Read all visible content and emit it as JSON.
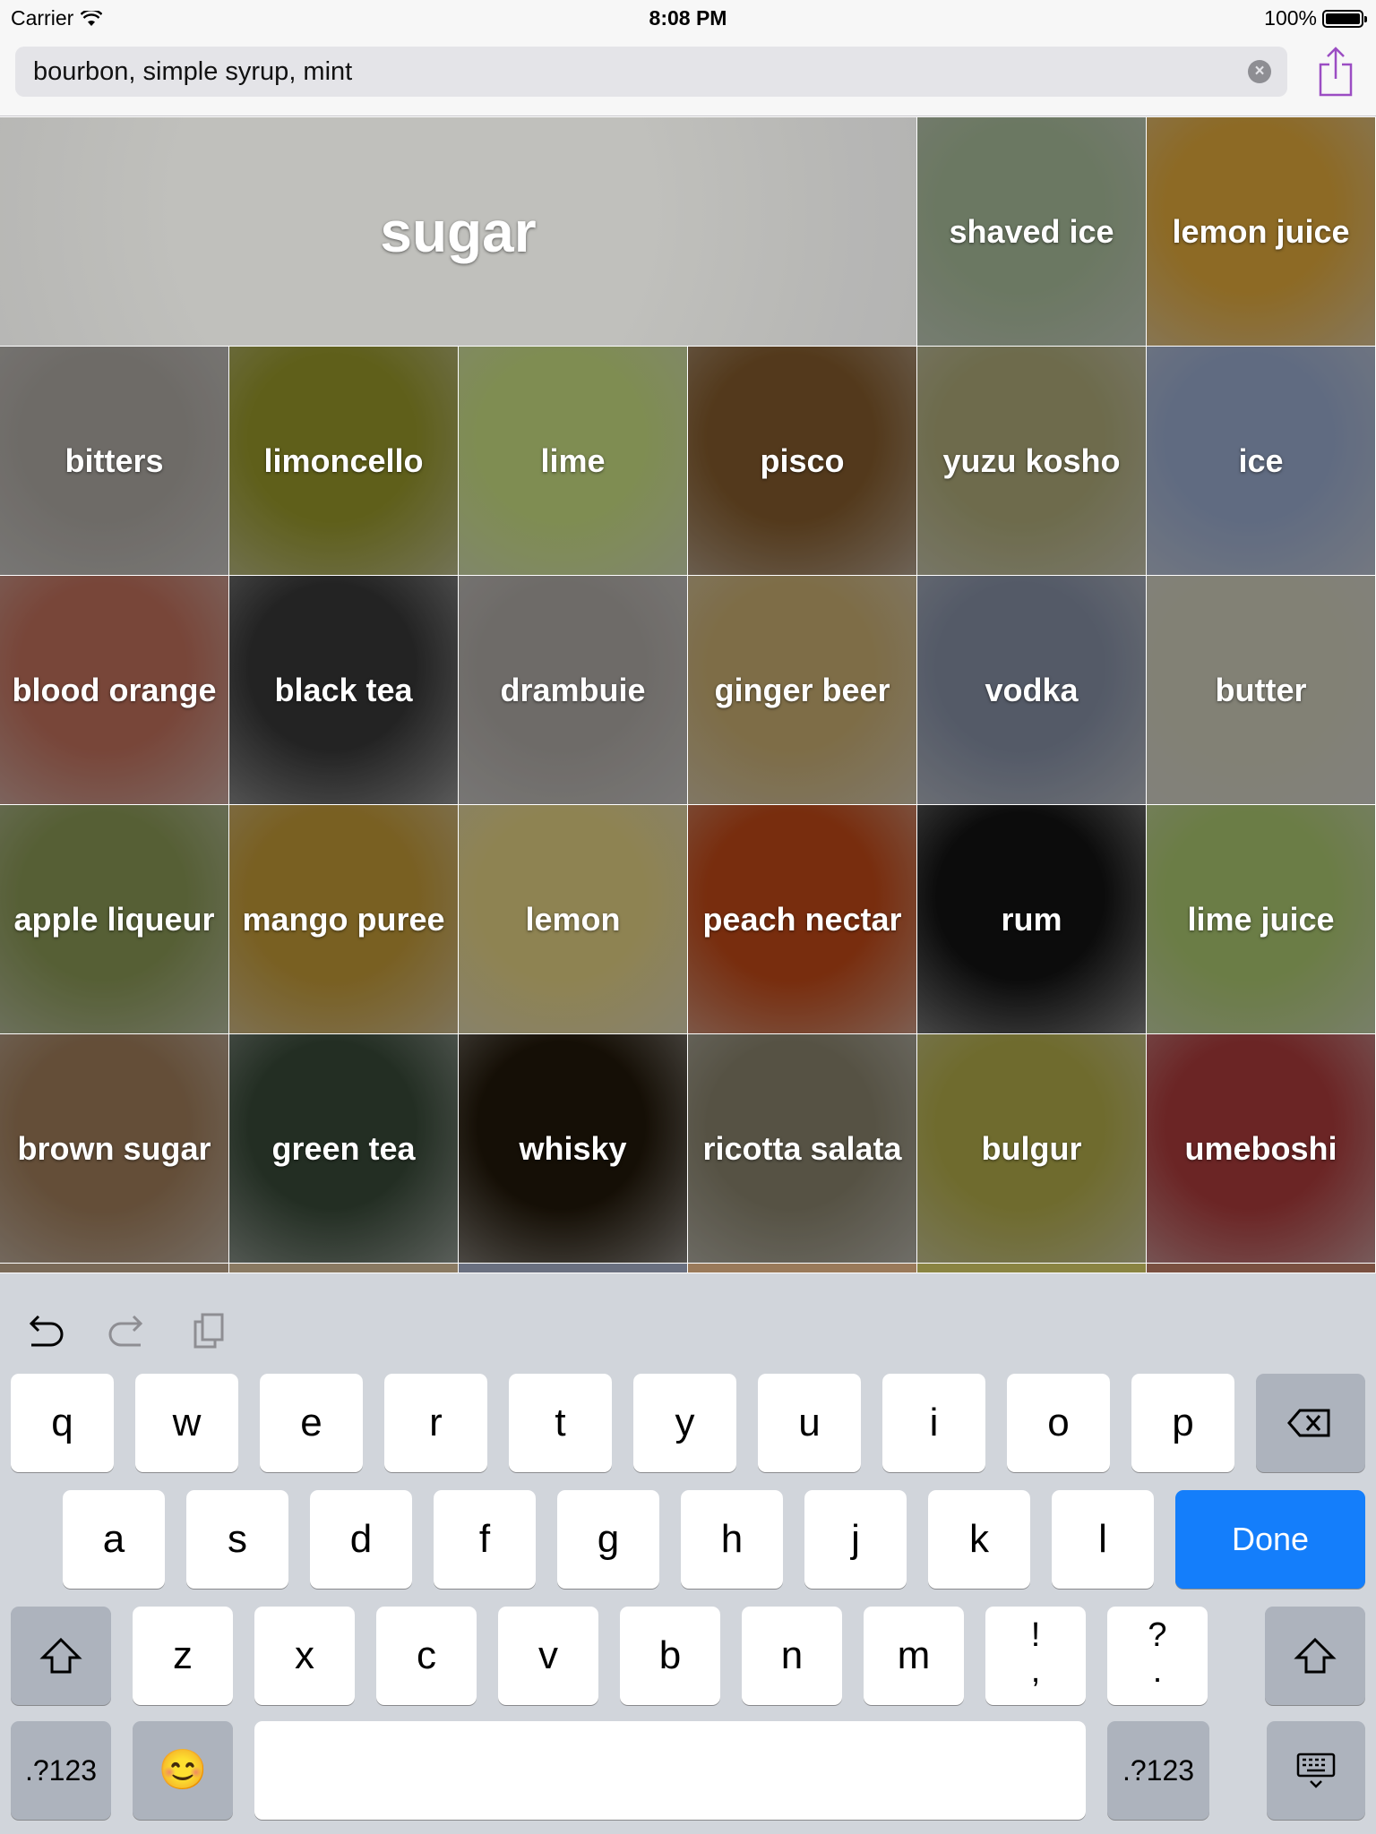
{
  "status_bar": {
    "carrier": "Carrier",
    "time": "8:08 PM",
    "battery": "100%"
  },
  "search": {
    "value": "bourbon, simple syrup, mint",
    "clear_icon": "clear-icon",
    "share_icon": "share-icon"
  },
  "tiles": [
    {
      "label": "sugar",
      "bg": "#bdbdb9"
    },
    {
      "label": "shaved ice",
      "bg": "#8a9a7e"
    },
    {
      "label": "lemon juice",
      "bg": "#b58830"
    },
    {
      "label": "bitters",
      "bg": "#8e8a85"
    },
    {
      "label": "limoncello",
      "bg": "#7a7a22"
    },
    {
      "label": "lime",
      "bg": "#a3b56a"
    },
    {
      "label": "pisco",
      "bg": "#6b4a24"
    },
    {
      "label": "yuzu kosho",
      "bg": "#8d8a62"
    },
    {
      "label": "ice",
      "bg": "#7c8aa6"
    },
    {
      "label": "blood orange",
      "bg": "#9a5a4a"
    },
    {
      "label": "black tea",
      "bg": "#2e2e2e"
    },
    {
      "label": "drambuie",
      "bg": "#8e8a86"
    },
    {
      "label": "ginger beer",
      "bg": "#a28c5c"
    },
    {
      "label": "vodka",
      "bg": "#6c7485"
    },
    {
      "label": "butter",
      "bg": "#a7a696"
    },
    {
      "label": "apple liqueur",
      "bg": "#6f7a45"
    },
    {
      "label": "mango puree",
      "bg": "#9c7b2c"
    },
    {
      "label": "lemon",
      "bg": "#b7a86a"
    },
    {
      "label": "peach nectar",
      "bg": "#9a3a12"
    },
    {
      "label": "rum",
      "bg": "#101010"
    },
    {
      "label": "lime juice",
      "bg": "#8aa05a"
    },
    {
      "label": "brown sugar",
      "bg": "#806448"
    },
    {
      "label": "green tea",
      "bg": "#2e3c2e"
    },
    {
      "label": "whisky",
      "bg": "#1c1408"
    },
    {
      "label": "ricotta salata",
      "bg": "#6f6a58"
    },
    {
      "label": "bulgur",
      "bg": "#8f8a3c"
    },
    {
      "label": "umeboshi",
      "bg": "#8a3030"
    }
  ],
  "partial_tile_colors": [
    "#7a6a58",
    "#8a7a62",
    "#6a7080",
    "#9a7a5a",
    "#8a8442",
    "#7a5040"
  ],
  "toolbar": {
    "undo_icon": "undo-icon",
    "redo_icon": "redo-icon",
    "paste_icon": "paste-icon"
  },
  "keyboard": {
    "row1": [
      "q",
      "w",
      "e",
      "r",
      "t",
      "y",
      "u",
      "i",
      "o",
      "p"
    ],
    "row2": [
      "a",
      "s",
      "d",
      "f",
      "g",
      "h",
      "j",
      "k",
      "l"
    ],
    "row3": [
      "z",
      "x",
      "c",
      "v",
      "b",
      "n",
      "m"
    ],
    "row3_punct": [
      {
        "top": "!",
        "bottom": ","
      },
      {
        "top": "?",
        "bottom": "."
      }
    ],
    "done_label": "Done",
    "numbers_label": ".?123",
    "emoji": "😊",
    "backspace_icon": "backspace-icon",
    "shift_icon": "shift-icon",
    "dismiss_icon": "keyboard-dismiss-icon"
  },
  "colors": {
    "accent": "#147efb",
    "caret": "#a050c8",
    "keyboard_bg": "#d1d5db"
  }
}
